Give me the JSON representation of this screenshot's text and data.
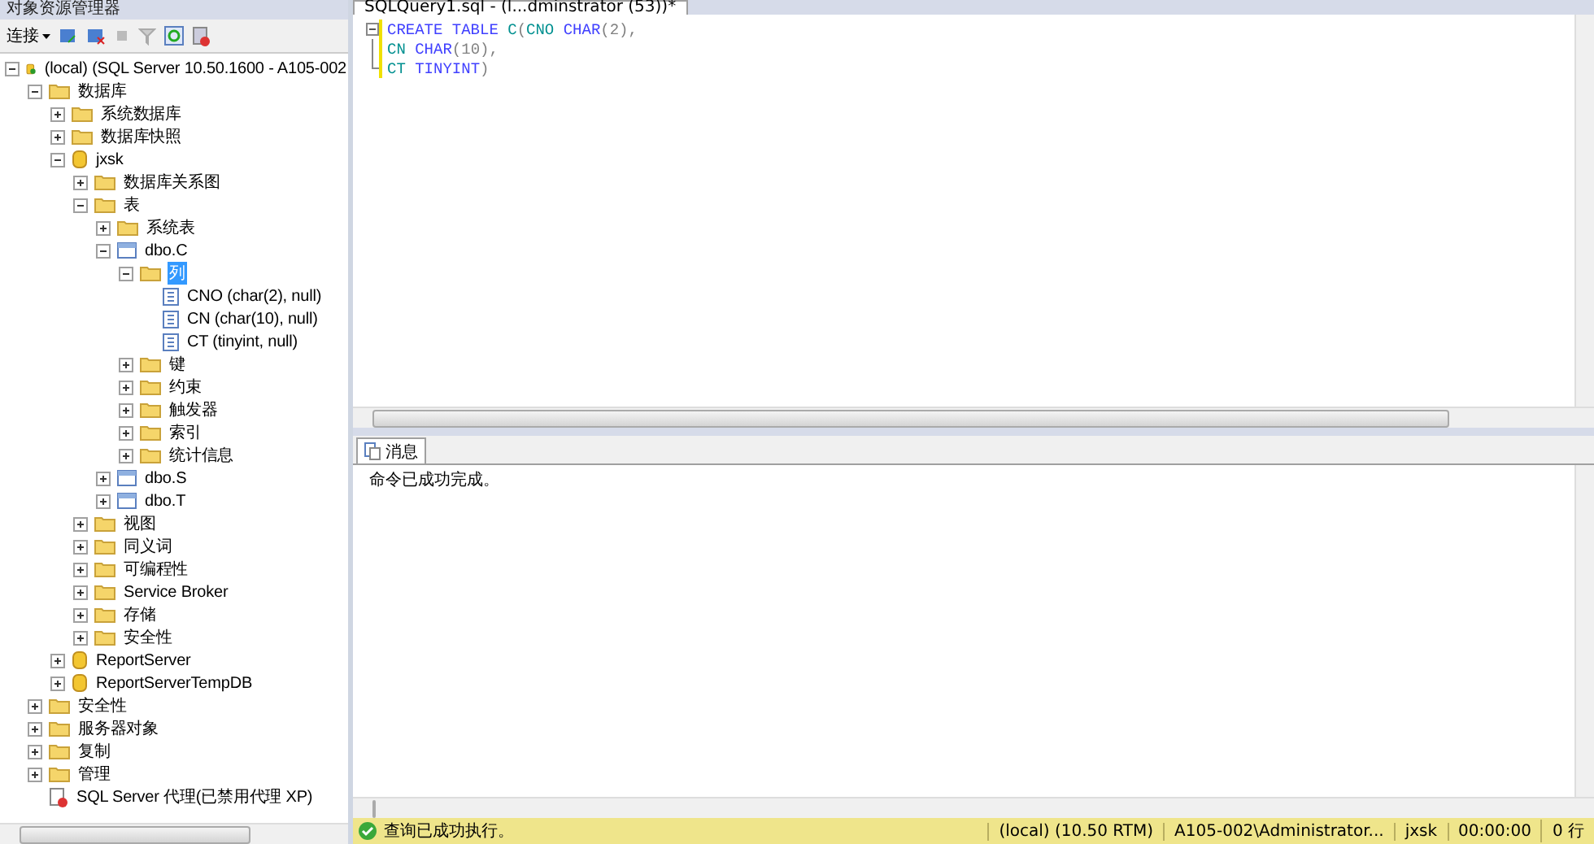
{
  "explorer": {
    "title": "对象资源管理器",
    "toolbar": {
      "connect": "连接"
    },
    "tree": [
      {
        "label": "(local) (SQL Server 10.50.1600 - A105-002",
        "kind": "server",
        "expanded": true,
        "selected": false,
        "children": [
          {
            "label": "数据库",
            "kind": "folder",
            "expanded": true,
            "selected": false,
            "children": [
              {
                "label": "系统数据库",
                "kind": "folder",
                "expanded": false,
                "selected": false
              },
              {
                "label": "数据库快照",
                "kind": "folder",
                "expanded": false,
                "selected": false
              },
              {
                "label": "jxsk",
                "kind": "database",
                "expanded": true,
                "selected": false,
                "children": [
                  {
                    "label": "数据库关系图",
                    "kind": "folder",
                    "expanded": false,
                    "selected": false
                  },
                  {
                    "label": "表",
                    "kind": "folder",
                    "expanded": true,
                    "selected": false,
                    "children": [
                      {
                        "label": "系统表",
                        "kind": "folder",
                        "expanded": false,
                        "selected": false
                      },
                      {
                        "label": "dbo.C",
                        "kind": "table",
                        "expanded": true,
                        "selected": false,
                        "children": [
                          {
                            "label": "列",
                            "kind": "folder",
                            "expanded": true,
                            "selected": true,
                            "children": [
                              {
                                "label": "CNO (char(2), null)",
                                "kind": "column",
                                "selected": false
                              },
                              {
                                "label": "CN (char(10), null)",
                                "kind": "column",
                                "selected": false
                              },
                              {
                                "label": "CT (tinyint, null)",
                                "kind": "column",
                                "selected": false
                              }
                            ]
                          },
                          {
                            "label": "键",
                            "kind": "folder",
                            "expanded": false,
                            "selected": false
                          },
                          {
                            "label": "约束",
                            "kind": "folder",
                            "expanded": false,
                            "selected": false
                          },
                          {
                            "label": "触发器",
                            "kind": "folder",
                            "expanded": false,
                            "selected": false
                          },
                          {
                            "label": "索引",
                            "kind": "folder",
                            "expanded": false,
                            "selected": false
                          },
                          {
                            "label": "统计信息",
                            "kind": "folder",
                            "expanded": false,
                            "selected": false
                          }
                        ]
                      },
                      {
                        "label": "dbo.S",
                        "kind": "table",
                        "expanded": false,
                        "selected": false
                      },
                      {
                        "label": "dbo.T",
                        "kind": "table",
                        "expanded": false,
                        "selected": false
                      }
                    ]
                  },
                  {
                    "label": "视图",
                    "kind": "folder",
                    "expanded": false,
                    "selected": false
                  },
                  {
                    "label": "同义词",
                    "kind": "folder",
                    "expanded": false,
                    "selected": false
                  },
                  {
                    "label": "可编程性",
                    "kind": "folder",
                    "expanded": false,
                    "selected": false
                  },
                  {
                    "label": "Service Broker",
                    "kind": "folder",
                    "expanded": false,
                    "selected": false
                  },
                  {
                    "label": "存储",
                    "kind": "folder",
                    "expanded": false,
                    "selected": false
                  },
                  {
                    "label": "安全性",
                    "kind": "folder",
                    "expanded": false,
                    "selected": false
                  }
                ]
              },
              {
                "label": "ReportServer",
                "kind": "database",
                "expanded": false,
                "selected": false
              },
              {
                "label": "ReportServerTempDB",
                "kind": "database",
                "expanded": false,
                "selected": false
              }
            ]
          },
          {
            "label": "安全性",
            "kind": "folder",
            "expanded": false,
            "selected": false
          },
          {
            "label": "服务器对象",
            "kind": "folder",
            "expanded": false,
            "selected": false
          },
          {
            "label": "复制",
            "kind": "folder",
            "expanded": false,
            "selected": false
          },
          {
            "label": "管理",
            "kind": "folder",
            "expanded": false,
            "selected": false
          },
          {
            "label": "SQL Server 代理(已禁用代理 XP)",
            "kind": "agent",
            "selected": false
          }
        ]
      }
    ]
  },
  "editor": {
    "tab": "SQLQuery1.sql - (l...dminstrator (53))*",
    "lines": [
      [
        {
          "text": "CREATE TABLE ",
          "kind": "keyword"
        },
        {
          "text": "C",
          "kind": "ident"
        },
        {
          "text": "(",
          "kind": "punct"
        },
        {
          "text": "CNO ",
          "kind": "ident"
        },
        {
          "text": "CHAR",
          "kind": "keyword"
        },
        {
          "text": "(2),",
          "kind": "punct"
        }
      ],
      [
        {
          "text": "CN ",
          "kind": "ident"
        },
        {
          "text": "CHAR",
          "kind": "keyword"
        },
        {
          "text": "(10),",
          "kind": "punct"
        }
      ],
      [
        {
          "text": "CT ",
          "kind": "ident"
        },
        {
          "text": "TINYINT",
          "kind": "keyword"
        },
        {
          "text": ")",
          "kind": "punct"
        }
      ]
    ]
  },
  "results": {
    "tabs": [
      {
        "label": "消息",
        "selected": true
      }
    ],
    "message": "命令已成功完成。"
  },
  "status_bar": {
    "message": "查询已成功执行。",
    "segments": [
      "(local) (10.50 RTM)",
      "A105-002\\Administrator...",
      "jxsk",
      "00:00:00",
      "0 行"
    ]
  }
}
